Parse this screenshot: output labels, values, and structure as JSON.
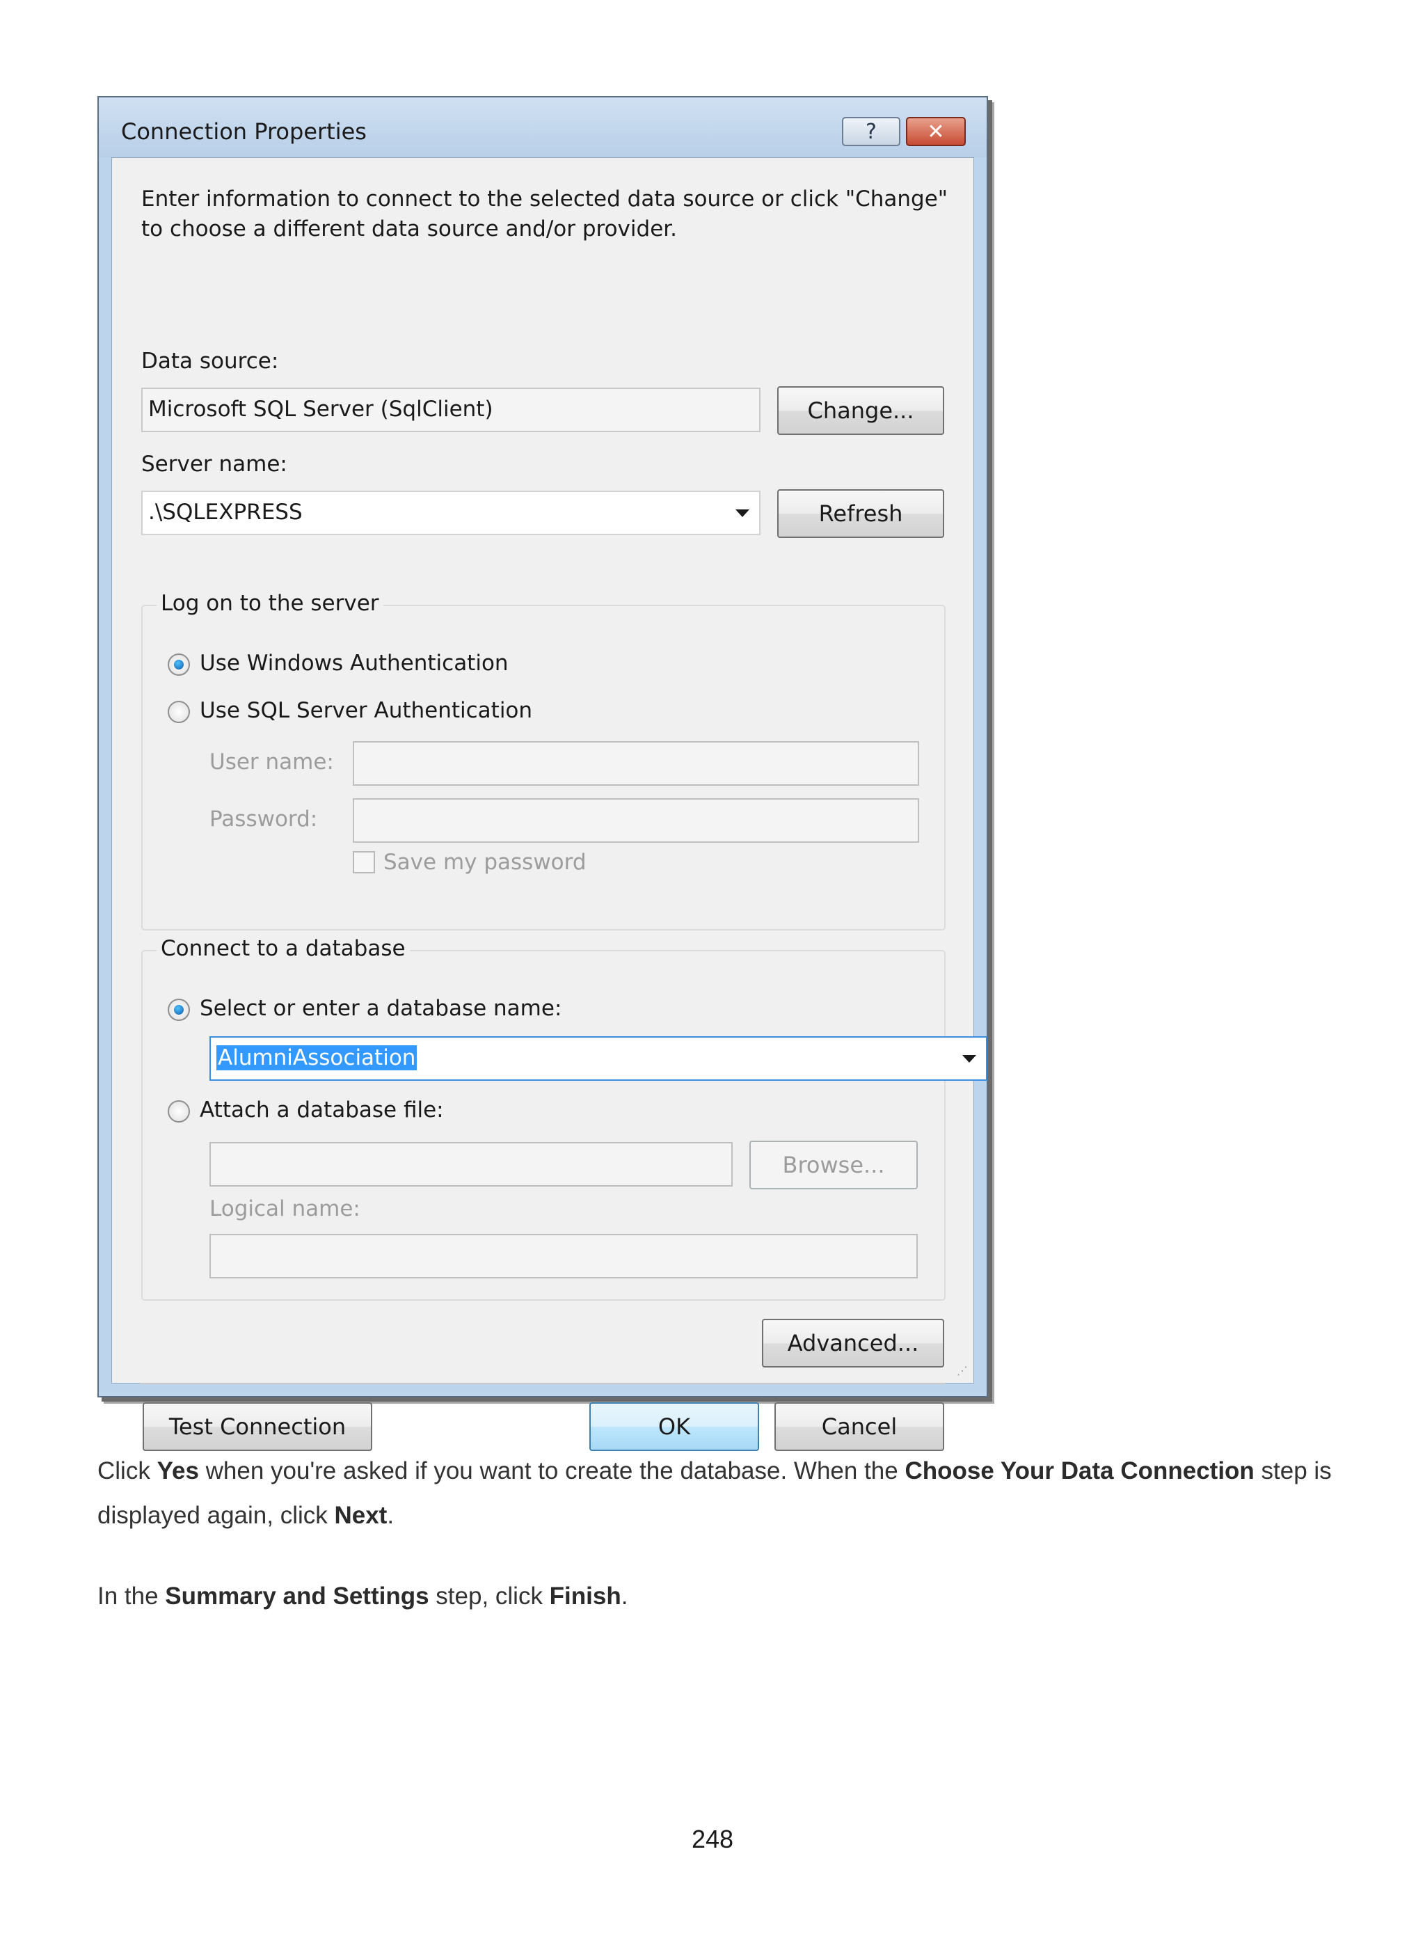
{
  "dialog": {
    "title": "Connection Properties",
    "help_glyph": "?",
    "close_glyph": "✕",
    "intro": "Enter information to connect to the selected data source or click \"Change\" to choose a different data source and/or provider.",
    "data_source_label": "Data source:",
    "data_source_value": "Microsoft SQL Server (SqlClient)",
    "change_button": "Change...",
    "server_name_label": "Server name:",
    "server_name_value": ".\\SQLEXPRESS",
    "refresh_button": "Refresh",
    "logon_group": {
      "title": "Log on to the server",
      "windows_auth": "Use Windows Authentication",
      "sql_auth": "Use SQL Server Authentication",
      "user_name_label": "User name:",
      "password_label": "Password:",
      "save_password": "Save my password",
      "selected": "windows_auth"
    },
    "database_group": {
      "title": "Connect to a database",
      "select_db": "Select or enter a database name:",
      "db_name_value": "AlumniAssociation",
      "attach_file": "Attach a database file:",
      "browse_button": "Browse...",
      "logical_name_label": "Logical name:",
      "selected": "select_db"
    },
    "advanced_button": "Advanced...",
    "test_connection_button": "Test Connection",
    "ok_button": "OK",
    "cancel_button": "Cancel"
  },
  "text": {
    "p1_a": "Click ",
    "p1_b": "Yes",
    "p1_c": " when you're asked if you want to create the database. When the ",
    "p1_d": "Choose Your Data Connection",
    "p1_e": " step is displayed again, click ",
    "p1_f": "Next",
    "p1_g": ".",
    "p2_a": "In the ",
    "p2_b": "Summary and Settings",
    "p2_c": " step, click ",
    "p2_d": "Finish",
    "p2_e": "."
  },
  "page_number": "248"
}
